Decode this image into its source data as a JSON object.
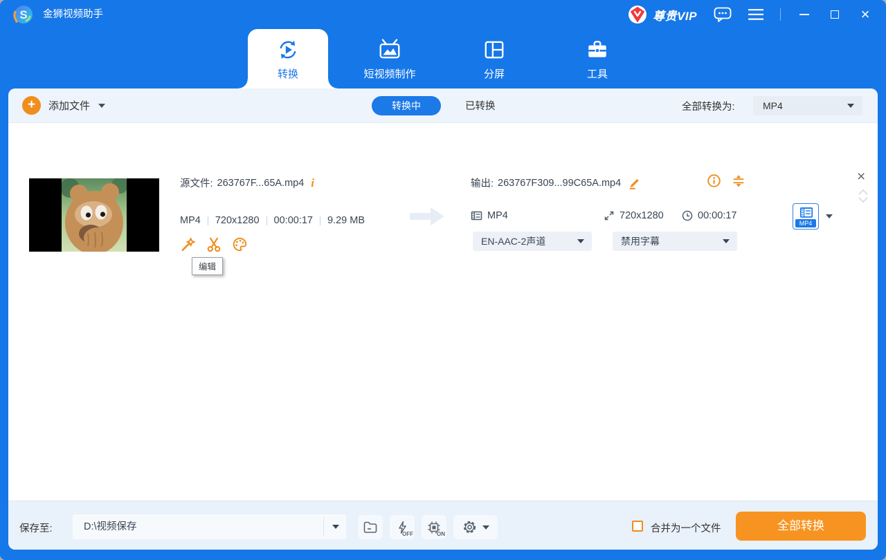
{
  "window": {
    "app_title": "金狮视频助手",
    "vip_label": "尊贵VIP"
  },
  "tabs": {
    "convert": "转换",
    "short_video": "短视频制作",
    "split_screen": "分屏",
    "tools": "工具"
  },
  "toolbar": {
    "add_files": "添加文件",
    "converting": "转换中",
    "converted": "已转换",
    "convert_all_to": "全部转换为:",
    "format_selected": "MP4"
  },
  "file": {
    "source_label": "源文件:",
    "source_name": "263767F...65A.mp4",
    "meta": {
      "format": "MP4",
      "resolution": "720x1280",
      "duration": "00:00:17",
      "size": "9.29 MB"
    },
    "edit_tooltip": "编辑",
    "output_label": "输出:",
    "output_name": "263767F309...99C65A.mp4",
    "out_format": "MP4",
    "out_resolution": "720x1280",
    "out_duration": "00:00:17",
    "audio_track": "EN-AAC-2声道",
    "subtitle": "禁用字幕",
    "format_badge": "MP4"
  },
  "bottombar": {
    "save_to": "保存至:",
    "save_path": "D:\\视频保存",
    "hw_off": "OFF",
    "hw_on": "ON",
    "merge": "合并为一个文件",
    "convert_all": "全部转换"
  },
  "icons": {
    "logo": "app-logo-s",
    "vip": "red-gem-badge",
    "chat": "message-bubble",
    "menu": "hamburger-menu",
    "tab_convert": "circular-arrows-play",
    "tab_short_video": "tv-mountains",
    "tab_split": "split-layout",
    "tab_tools": "briefcase",
    "add": "plus-circle",
    "source_info": "italic-i",
    "edit": "magic-wand",
    "trim": "scissors",
    "effects": "palette",
    "rename": "pencil",
    "output_info": "circled-i",
    "settings_tune": "tune-sliders",
    "video": "film-strip",
    "resolution": "expand-arrows",
    "duration": "clock",
    "folder": "folder",
    "hardware_accel": "lightning",
    "gpu": "chip",
    "settings": "gear"
  },
  "colors": {
    "primary_blue": "#1677E8",
    "accent_orange": "#EF8E1F",
    "button_orange": "#F79421"
  }
}
